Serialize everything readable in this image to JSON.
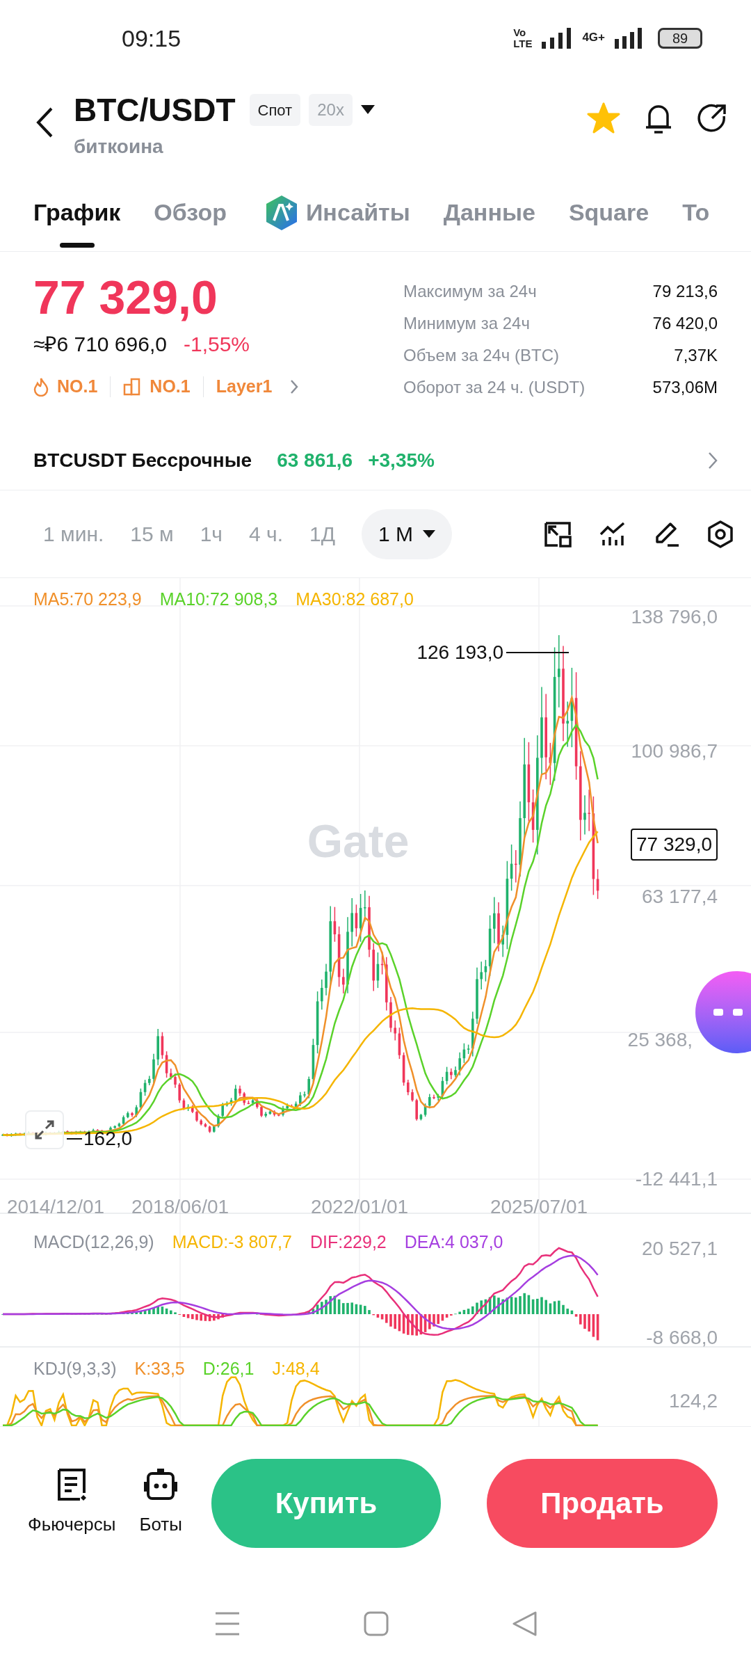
{
  "status_bar": {
    "time": "09:15",
    "volte": [
      "Vo",
      "LTE"
    ],
    "network": "4G+",
    "battery": "89"
  },
  "header": {
    "title": "BTC/USDT",
    "badges": [
      "Спот",
      "20x"
    ],
    "subtitle": "биткоина",
    "favorite": true
  },
  "tabs": [
    {
      "label": "График",
      "kind": "text",
      "selected": true
    },
    {
      "label": "Обзор",
      "kind": "text",
      "selected": false
    },
    {
      "label": "Инсайты",
      "kind": "ai",
      "selected": false
    },
    {
      "label": "Данные",
      "kind": "text",
      "selected": false
    },
    {
      "label": "Square",
      "kind": "text",
      "selected": false
    },
    {
      "label": "To",
      "kind": "text",
      "selected": false
    }
  ],
  "ticker": {
    "price": "77 329,0",
    "fiat": "≈₽6 710 696,0",
    "change": "-1,55%",
    "tags": [
      {
        "kind": "fire",
        "label": "NO.1"
      },
      {
        "kind": "blocks",
        "label": "NO.1"
      },
      {
        "kind": "link",
        "label": "Layer1"
      }
    ],
    "stats": [
      {
        "label": "Максимум за 24ч",
        "value": "79 213,6"
      },
      {
        "label": "Минимум за 24ч",
        "value": "76 420,0"
      },
      {
        "label": "Объем за 24ч (BTC)",
        "value": "7,37K"
      },
      {
        "label": "Оборот за 24 ч. (USDT)",
        "value": "573,06M"
      }
    ]
  },
  "perpetual": {
    "name": "BTCUSDT Бессрочные",
    "price": "63 861,6",
    "change": "+3,35%"
  },
  "timeframes": [
    {
      "label": "1 мин.",
      "selected": false
    },
    {
      "label": "15 м",
      "selected": false
    },
    {
      "label": "1ч",
      "selected": false
    },
    {
      "label": "4 ч.",
      "selected": false
    },
    {
      "label": "1Д",
      "selected": false
    },
    {
      "label": "1 М",
      "selected": true
    }
  ],
  "main_chart": {
    "legend": [
      {
        "label": "MA5:70 223,9",
        "color": "#f0902a"
      },
      {
        "label": "MA10:72 908,3",
        "color": "#5ad22a"
      },
      {
        "label": "MA30:82 687,0",
        "color": "#f5b500"
      }
    ],
    "y_labels": [
      "138 796,0",
      "100 986,7",
      "63 177,4",
      "25 368,",
      "-12 441,1"
    ],
    "x_labels": [
      "2014/12/01",
      "2018/06/01",
      "2022/01/01",
      "2025/07/01"
    ],
    "high_label": "126 193,0",
    "low_label": "162,0",
    "price_tag": "77 329,0",
    "watermark": "Gate"
  },
  "macd": {
    "legend": [
      {
        "label": "MACD(12,26,9)",
        "color": "#8a8f98"
      },
      {
        "label": "MACD:-3 807,7",
        "color": "#f5b500"
      },
      {
        "label": "DIF:229,2",
        "color": "#e8307a"
      },
      {
        "label": "DEA:4 037,0",
        "color": "#a53ee0"
      }
    ],
    "y_labels": [
      "20 527,1",
      "-8 668,0"
    ]
  },
  "kdj": {
    "legend": [
      {
        "label": "KDJ(9,3,3)",
        "color": "#8a8f98"
      },
      {
        "label": "K:33,5",
        "color": "#f0902a"
      },
      {
        "label": "D:26,1",
        "color": "#5ad22a"
      },
      {
        "label": "J:48,4",
        "color": "#f5b500"
      }
    ],
    "y_labels": [
      "124,2"
    ]
  },
  "bottom_bar": {
    "shortcuts": [
      {
        "kind": "futures",
        "label": "Фьючерсы"
      },
      {
        "kind": "bots",
        "label": "Боты"
      }
    ],
    "buy": "Купить",
    "sell": "Продать"
  }
}
